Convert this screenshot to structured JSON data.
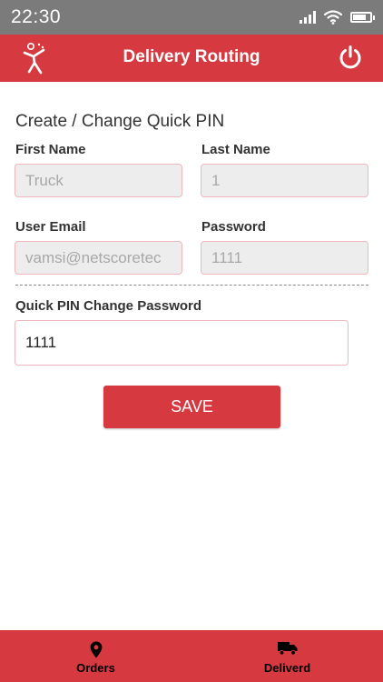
{
  "status_bar": {
    "time": "22:30"
  },
  "header": {
    "title": "Delivery Routing"
  },
  "form": {
    "section_title": "Create / Change Quick PIN",
    "first_name": {
      "label": "First Name",
      "value": "Truck"
    },
    "last_name": {
      "label": "Last Name",
      "value": "1"
    },
    "user_email": {
      "label": "User Email",
      "value": "vamsi@netscoretec"
    },
    "password": {
      "label": "Password",
      "value": "1111"
    },
    "quick_pin": {
      "label": "Quick PIN Change Password",
      "value": "1111"
    },
    "save_label": "SAVE"
  },
  "bottom_nav": {
    "items": [
      {
        "label": "Orders",
        "icon": "map-pin-icon"
      },
      {
        "label": "Deliverd",
        "icon": "truck-icon"
      }
    ]
  },
  "colors": {
    "accent": "#d6393f",
    "status_bar": "#7b7b7b",
    "field_border": "#f0b7bc",
    "disabled_field": "#ededed"
  }
}
